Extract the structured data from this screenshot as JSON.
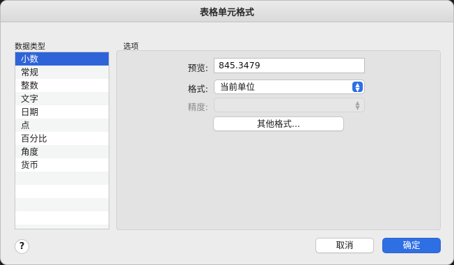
{
  "dialog": {
    "title": "表格单元格式"
  },
  "data_type": {
    "label": "数据类型",
    "items": [
      "小数",
      "常规",
      "整数",
      "文字",
      "日期",
      "点",
      "百分比",
      "角度",
      "货币"
    ],
    "selected": "小数"
  },
  "options": {
    "label": "选项",
    "preview_label": "预览:",
    "preview_value": "845.3479",
    "format_label": "格式:",
    "format_value": "当前单位",
    "precision_label": "精度:",
    "precision_value": "",
    "other_formats_button": "其他格式..."
  },
  "footer": {
    "help": "?",
    "cancel": "取消",
    "ok": "确定"
  }
}
